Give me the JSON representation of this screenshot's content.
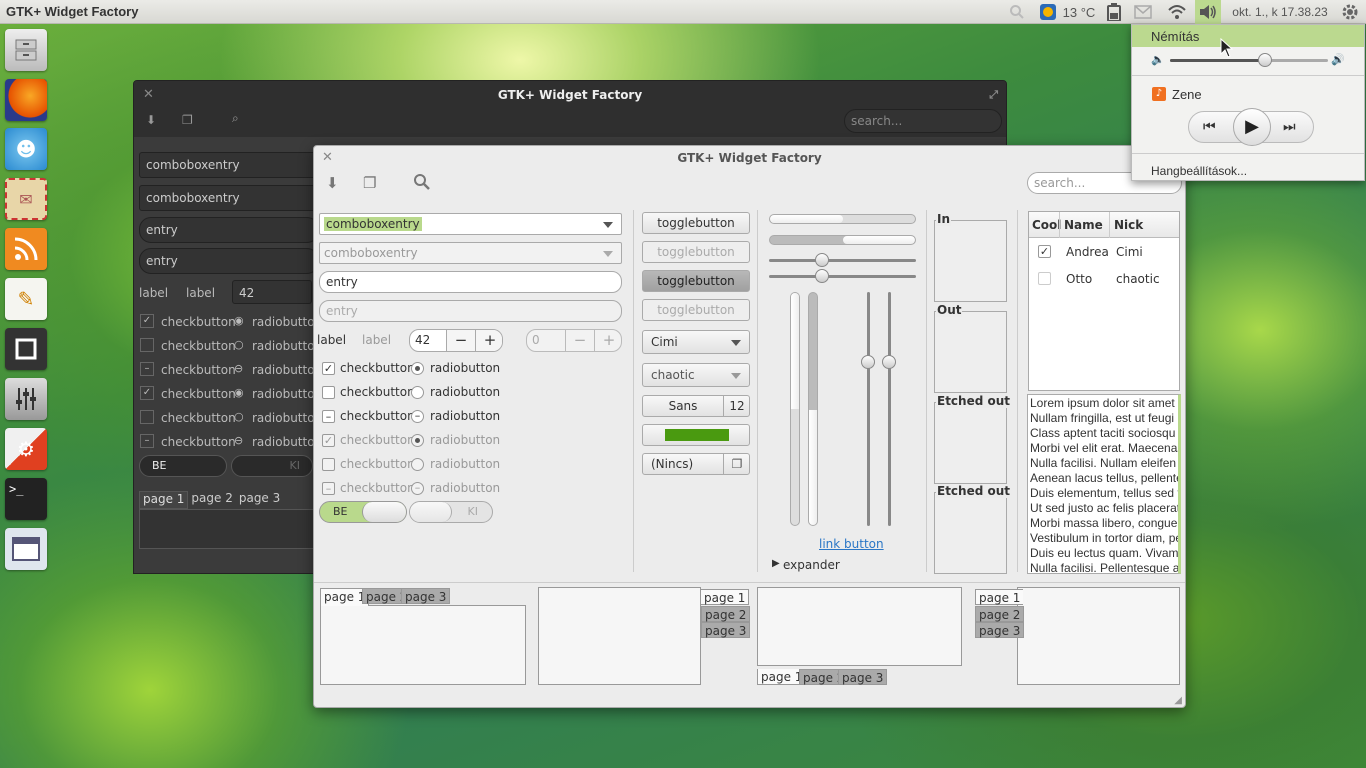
{
  "panel": {
    "app_title": "GTK+ Widget Factory",
    "temperature": "13 °C",
    "clock": "okt. 1., k 17.38.23"
  },
  "sound_menu": {
    "mute": "Némítás",
    "player": "Zene",
    "settings": "Hangbeállítások...",
    "volume": 0.6
  },
  "back_window": {
    "title": "GTK+ Widget Factory",
    "search_placeholder": "search...",
    "combo1": "comboboxentry",
    "combo2": "comboboxentry",
    "entry1": "entry",
    "entry2": "entry",
    "label1": "label",
    "label2": "label",
    "spin": "42",
    "checkbutton": "checkbutton",
    "radiobutton": "radiobutton",
    "switch_on": "BE",
    "switch_off": "KI",
    "tabs": [
      "page 1",
      "page 2",
      "page 3"
    ]
  },
  "front_window": {
    "title": "GTK+ Widget Factory",
    "search_placeholder": "search...",
    "combo1": "comboboxentry",
    "combo2": "comboboxentry",
    "entry1": "entry",
    "entry2": "entry",
    "label1": "label",
    "label2": "label",
    "spin1": "42",
    "spin2": "0",
    "checkbutton": "checkbutton",
    "radiobutton": "radiobutton",
    "switch_on": "BE",
    "switch_off": "KI",
    "togglebutton": "togglebutton",
    "combo_cimi": "Cimi",
    "combo_chaotic": "chaotic",
    "font_name": "Sans",
    "font_size": "12",
    "file_button": "(Nincs)",
    "color_button": "#4a9a10",
    "link_button": "link button",
    "expander": "expander",
    "frames": [
      "In",
      "Out",
      "Etched out",
      "Etched out"
    ],
    "tree_headers": [
      "Cool",
      "Name",
      "Nick"
    ],
    "tree_rows": [
      {
        "cool": true,
        "name": "Andrea",
        "nick": "Cimi"
      },
      {
        "cool": false,
        "name": "Otto",
        "nick": "chaotic"
      }
    ],
    "text_lines": [
      "Lorem ipsum dolor sit amet",
      "Nullam fringilla, est ut feugi",
      "Class aptent taciti sociosqu a",
      "Morbi vel elit erat. Maecenas",
      "Nulla facilisi. Nullam eleifen",
      "Aenean lacus tellus, pellente",
      "Duis elementum, tellus sed t",
      "Ut sed justo ac felis placerat",
      "Morbi massa libero, congue",
      "Vestibulum in tortor diam, pe",
      "Duis eu lectus quam. Vivamu",
      "Nulla facilisi. Pellentesque a"
    ],
    "tabs": [
      "page 1",
      "page 2",
      "page 3"
    ],
    "progress1": 0.5,
    "progress2": 0.5,
    "scale1": 0.36,
    "scale2": 0.36,
    "vscale1": 0.3,
    "vscale2": 0.3
  }
}
